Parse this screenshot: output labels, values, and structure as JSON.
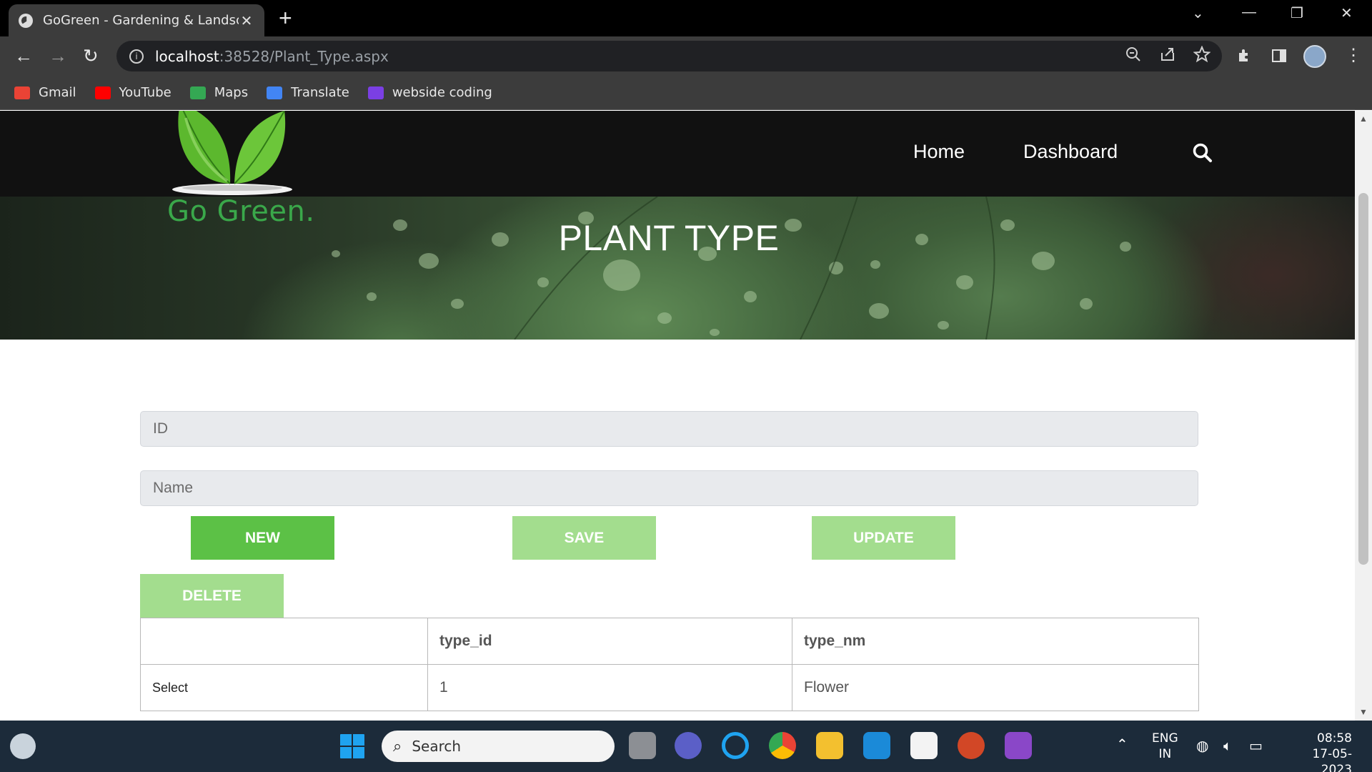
{
  "browser": {
    "tab_title": "GoGreen - Gardening & Landscap",
    "tab_close": "✕",
    "new_tab": "+",
    "url_host": "localhost",
    "url_path": ":38528/Plant_Type.aspx",
    "bookmarks": [
      {
        "label": "Gmail",
        "color": "#ea4335"
      },
      {
        "label": "YouTube",
        "color": "#ff0000"
      },
      {
        "label": "Maps",
        "color": "#34a853"
      },
      {
        "label": "Translate",
        "color": "#4285f4"
      },
      {
        "label": "webside coding",
        "color": "#7b3fe4"
      }
    ]
  },
  "site": {
    "logo_text": "Go Green.",
    "nav": {
      "home": "Home",
      "dashboard": "Dashboard"
    },
    "hero_title": "PLANT TYPE"
  },
  "form": {
    "id_placeholder": "ID",
    "name_placeholder": "Name",
    "buttons": {
      "new": "NEW",
      "save": "SAVE",
      "update": "UPDATE",
      "delete": "DELETE"
    }
  },
  "grid": {
    "headers": [
      "",
      "type_id",
      "type_nm"
    ],
    "rows": [
      {
        "action": "Select",
        "type_id": "1",
        "type_nm": "Flower"
      }
    ]
  },
  "taskbar": {
    "search_label": "Search",
    "lang_top": "ENG",
    "lang_bottom": "IN",
    "time": "08:58",
    "date": "17-05-2023"
  },
  "colors": {
    "brand_green": "#5cc146",
    "muted_green": "#a3dd8e",
    "logo_green": "#3aa84a"
  }
}
